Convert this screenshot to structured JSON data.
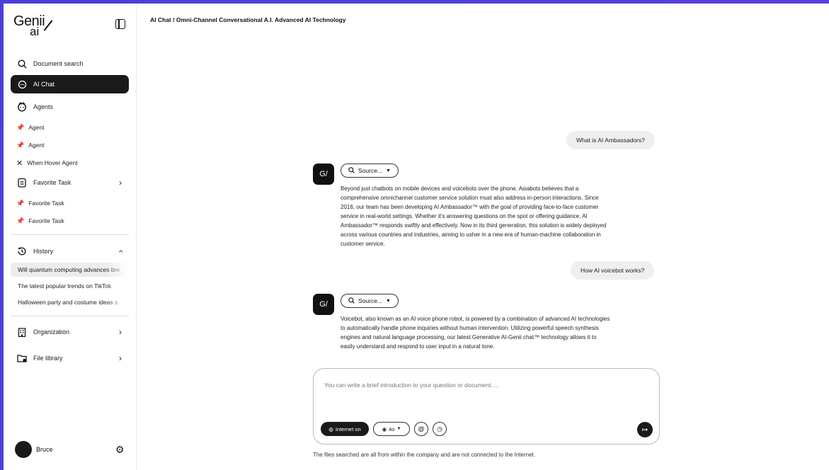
{
  "sidebar": {
    "logo": {
      "top": "Genii",
      "bottom": "ai"
    },
    "nav": {
      "document_search": "Document search",
      "ai_chat": "AI Chat",
      "agents": "Agents",
      "favorite_task": "Favorite Task",
      "history": "History",
      "organization": "Organization",
      "file_library": "File library"
    },
    "agents": [
      "Agent",
      "Agent",
      "When Hover Agent"
    ],
    "favorites": [
      "Favorite Task",
      "Favorite Task"
    ],
    "history_items": [
      "Will quantum computing advances bre",
      "The latest popular trends on TikTok",
      "Halloween party and costume ideas s"
    ],
    "user_name": "Bruce"
  },
  "breadcrumb": "AI Chat  /  Omni-Channel Conversational A.I. Advanced AI Technology",
  "conversation": {
    "q1": "What is AI Ambassadors?",
    "a1": "Beyond just chatbots on mobile devices and voicebots over the phone, Asiabots believes that a comprehensive omnichannel customer service solution must also address in-person interactions. Since 2016, our team has been developing AI Ambassador™ with the goal of providing face-to-face customer service in real-world settings. Whether it's answering questions on the spot or offering guidance, AI Ambassador™ responds swiftly and effectively. Now in its third generation, this solution is widely deployed across various countries and industries, aiming to usher in a new era of human-machine collaboration in customer service.",
    "q2": "How AI voicebot works?",
    "a2": "Voicebot, also known as an AI voice phone robot, is powered by a combination of advanced AI technologies to automatically handle phone inquiries without human intervention. Utilizing powerful speech synthesis engines and natural language processing, our latest Generative AI-Genii chat™ technology allows it to easily understand and respond to user input in a natural tone.",
    "source_label": "Source..."
  },
  "composer": {
    "placeholder": "You can write a brief introduction to your question or document. ...",
    "internet_label": "Internet on",
    "model_label": "4o"
  },
  "footer_note": "The files searched are all from within the company and are not connected to the Internet.",
  "colors": {
    "accent_bg": "#4b3fd8",
    "dark": "#1a1a1a",
    "pin": "#2f6fe0"
  }
}
